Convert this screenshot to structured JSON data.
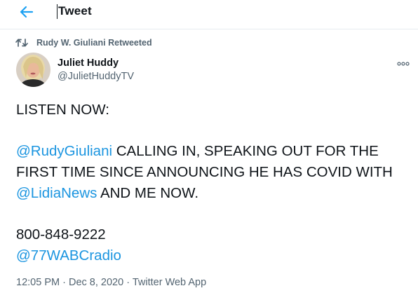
{
  "header": {
    "title": "Tweet",
    "back_icon": "arrow-left-icon",
    "accent": "#1da1f2"
  },
  "retweet_banner": {
    "label": "Rudy W. Giuliani Retweeted",
    "icon": "retweet-icon"
  },
  "author": {
    "name": "Juliet Huddy",
    "handle": "@JulietHuddyTV",
    "avatar_icon": "profile-photo"
  },
  "more_icon": "more-options-icon",
  "tweet": {
    "line1": "LISTEN NOW:",
    "mention1": "@RudyGiuliani",
    "line2_rest": " CALLING IN, SPEAKING OUT FOR THE",
    "line3": "FIRST TIME SINCE ANNOUNCING HE HAS COVID WITH",
    "mention2": "@LidiaNews",
    "line4_rest": " AND ME NOW.",
    "phone": "800-848-9222",
    "mention3": "@77WABCradio"
  },
  "meta": {
    "time": "12:05 PM",
    "date": "Dec 8, 2020",
    "source": "Twitter Web App",
    "separator": "·"
  },
  "colors": {
    "link": "#1b95e0",
    "secondary": "#536471",
    "text": "#0f1419"
  }
}
